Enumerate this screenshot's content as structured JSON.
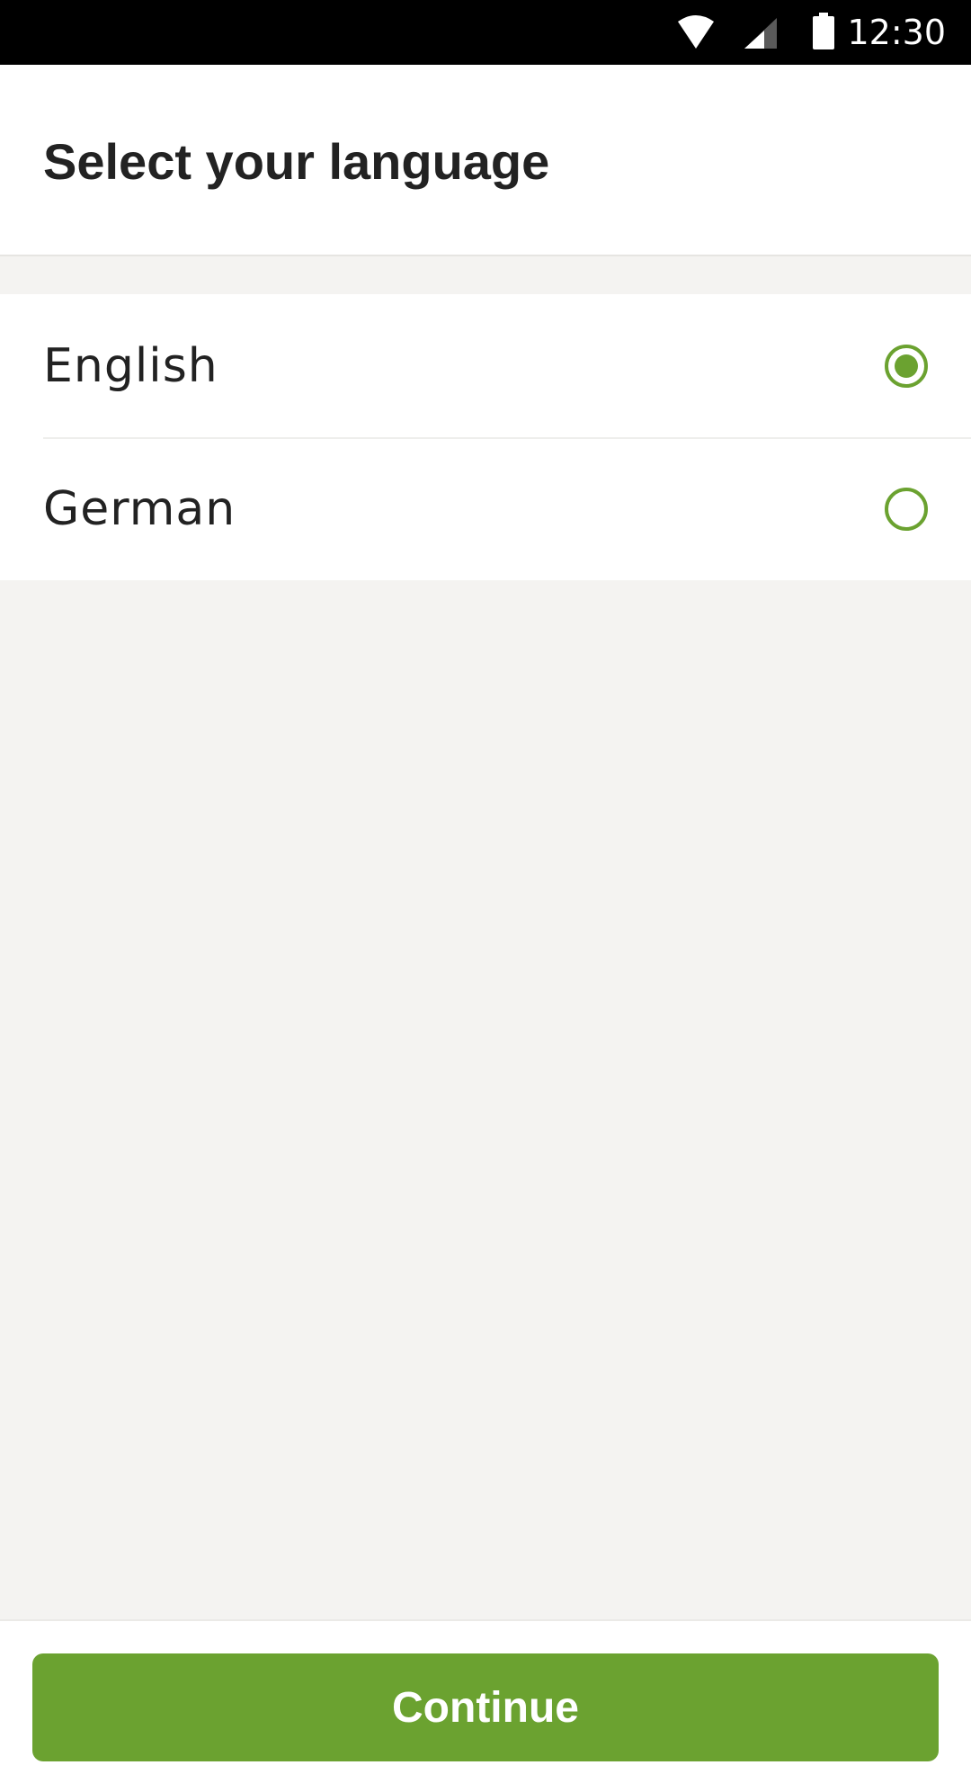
{
  "status_bar": {
    "time": "12:30",
    "icons": [
      "wifi-icon",
      "cell-signal-icon",
      "battery-icon"
    ]
  },
  "header": {
    "title": "Select your language"
  },
  "languages": [
    {
      "label": "English",
      "selected": true
    },
    {
      "label": "German",
      "selected": false
    }
  ],
  "footer": {
    "continue_label": "Continue"
  },
  "colors": {
    "accent": "#6ba230",
    "background": "#f4f3f1",
    "text": "#222222"
  }
}
